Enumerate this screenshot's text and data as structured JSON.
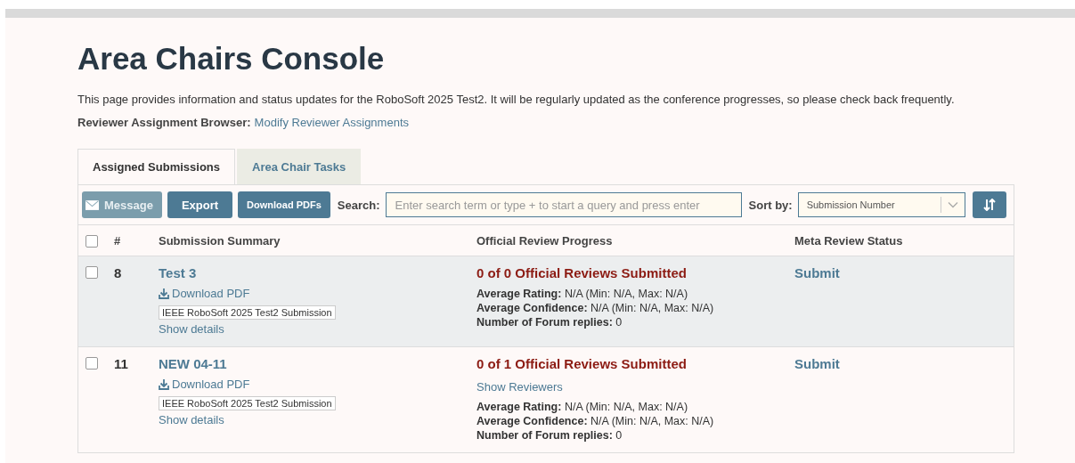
{
  "page": {
    "title": "Area Chairs Console",
    "description": "This page provides information and status updates for the RoboSoft 2025 Test2. It will be regularly updated as the conference progresses, so please check back frequently.",
    "assignment_label": "Reviewer Assignment Browser:",
    "assignment_link": "Modify Reviewer Assignments"
  },
  "tabs": [
    {
      "label": "Assigned Submissions",
      "selected": true
    },
    {
      "label": "Area Chair Tasks",
      "selected": false
    }
  ],
  "toolbar": {
    "buttons": [
      {
        "label": "Message",
        "kind": "message",
        "disabled": true
      },
      {
        "label": "Export",
        "kind": "plain",
        "disabled": false
      },
      {
        "label": "Download PDFs",
        "kind": "small",
        "disabled": false
      }
    ],
    "search_label": "Search:",
    "search_placeholder": "Enter search term or type + to start a query and press enter",
    "sort_label": "Sort by:",
    "sort_value": "Submission Number"
  },
  "table": {
    "select_all_checked": false,
    "columns": [
      "#",
      "Submission Summary",
      "Official Review Progress",
      "Meta Review Status"
    ],
    "rows": [
      {
        "checked": false,
        "highlighted": true,
        "number": "8",
        "title": "Test 3",
        "download": "Download PDF",
        "venue": "IEEE RoboSoft 2025 Test2 Submission",
        "details": "Show details",
        "progress": "0 of 0 Official Reviews Submitted",
        "reviewers_link": "",
        "stats": [
          {
            "label": "Average Rating:",
            "value": "N/A (Min: N/A, Max: N/A)"
          },
          {
            "label": "Average Confidence:",
            "value": "N/A (Min: N/A, Max: N/A)"
          },
          {
            "label": "Number of Forum replies:",
            "value": "0"
          }
        ],
        "meta": "Submit"
      },
      {
        "checked": false,
        "highlighted": false,
        "number": "11",
        "title": "NEW 04-11",
        "download": "Download PDF",
        "venue": "IEEE RoboSoft 2025 Test2 Submission",
        "details": "Show details",
        "progress": "0 of 1 Official Reviews Submitted",
        "reviewers_link": "Show Reviewers",
        "stats": [
          {
            "label": "Average Rating:",
            "value": "N/A (Min: N/A, Max: N/A)"
          },
          {
            "label": "Average Confidence:",
            "value": "N/A (Min: N/A, Max: N/A)"
          },
          {
            "label": "Number of Forum replies:",
            "value": "0"
          }
        ],
        "meta": "Submit"
      }
    ]
  }
}
